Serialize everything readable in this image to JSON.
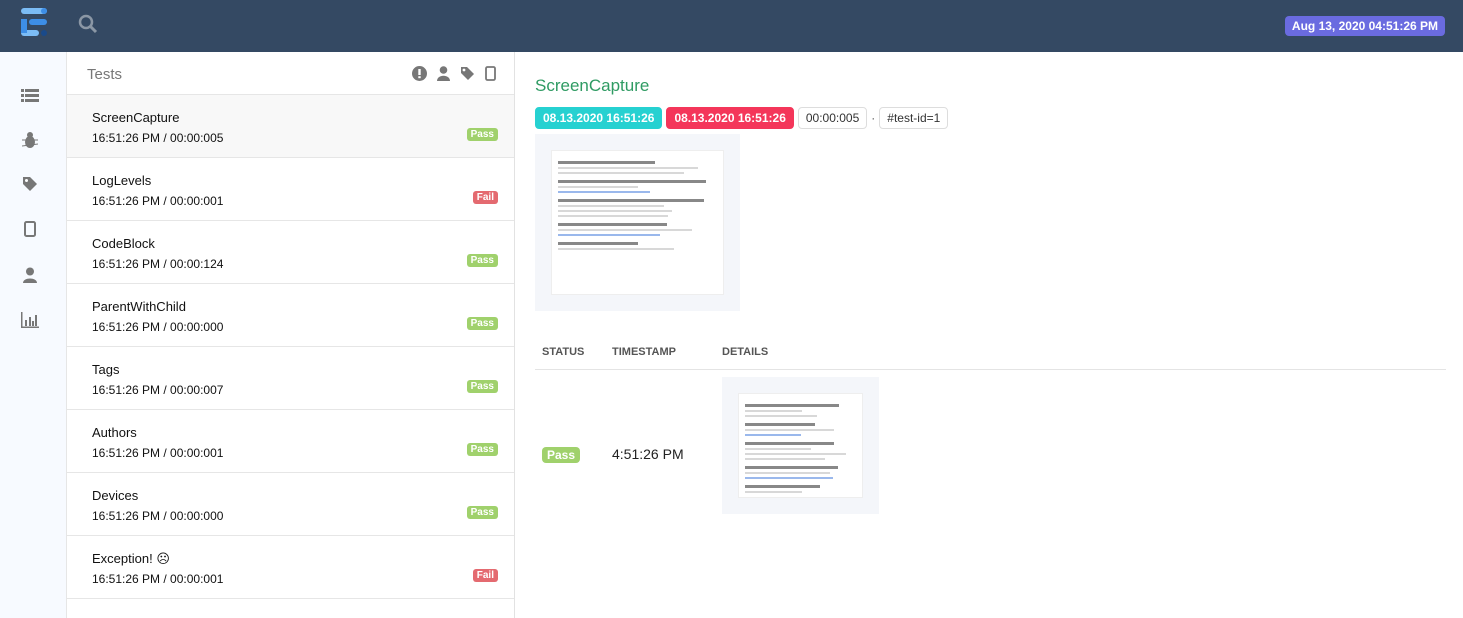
{
  "header": {
    "date": "Aug 13, 2020 04:51:26 PM"
  },
  "sidebar": {
    "icons": [
      "list-icon",
      "bug-icon",
      "tag-icon",
      "tablet-icon",
      "user-icon",
      "bar-chart-icon"
    ]
  },
  "tests_panel": {
    "title": "Tests",
    "filter_icons": [
      "exclamation-icon",
      "user-icon",
      "tag-icon",
      "tablet-icon"
    ]
  },
  "tests": [
    {
      "name": "ScreenCapture",
      "meta": "16:51:26 PM / 00:00:005",
      "status": "Pass"
    },
    {
      "name": "LogLevels",
      "meta": "16:51:26 PM / 00:00:001",
      "status": "Fail"
    },
    {
      "name": "CodeBlock",
      "meta": "16:51:26 PM / 00:00:124",
      "status": "Pass"
    },
    {
      "name": "ParentWithChild",
      "meta": "16:51:26 PM / 00:00:000",
      "status": "Pass"
    },
    {
      "name": "Tags",
      "meta": "16:51:26 PM / 00:00:007",
      "status": "Pass"
    },
    {
      "name": "Authors",
      "meta": "16:51:26 PM / 00:00:001",
      "status": "Pass"
    },
    {
      "name": "Devices",
      "meta": "16:51:26 PM / 00:00:000",
      "status": "Pass"
    },
    {
      "name": "Exception! ☹",
      "meta": "16:51:26 PM / 00:00:001",
      "status": "Fail"
    }
  ],
  "detail": {
    "title": "ScreenCapture",
    "start": "08.13.2020 16:51:26",
    "end": "08.13.2020 16:51:26",
    "duration": "00:00:005",
    "separator": "·",
    "test_id": "#test-id=1",
    "log_headers": {
      "status": "STATUS",
      "timestamp": "TIMESTAMP",
      "details": "DETAILS"
    },
    "log": [
      {
        "status": "Pass",
        "timestamp": "4:51:26 PM"
      }
    ]
  },
  "colors": {
    "topbar": "#344963",
    "pass": "#a0d16c",
    "fail": "#e46a70",
    "start": "#26d1d1",
    "end": "#f4365a",
    "title": "#2f9b63",
    "date_badge": "#6a6be0"
  }
}
